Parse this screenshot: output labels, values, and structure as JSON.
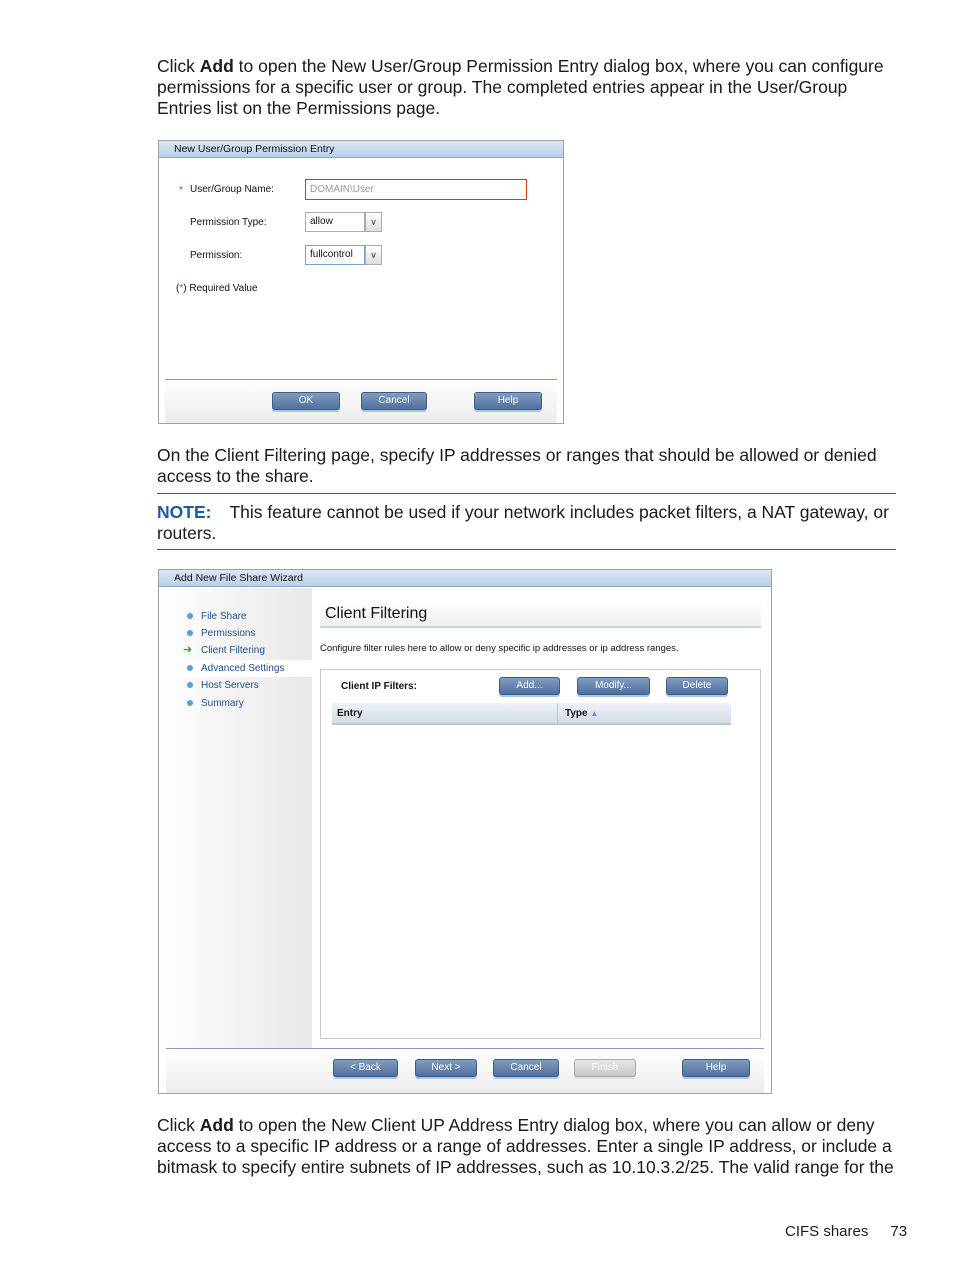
{
  "paragraphs": {
    "p1": {
      "pre": "Click ",
      "bold": "Add",
      "post": " to open the New User/Group Permission Entry dialog box, where you can configure permissions for a specific user or group. The completed entries appear in the User/Group Entries list on the Permissions page."
    },
    "p2": "On the Client Filtering page, specify IP addresses or ranges that should be allowed or denied access to the share.",
    "note": {
      "label": "NOTE:",
      "text": "This feature cannot be used if your network includes packet filters, a NAT gateway, or routers."
    },
    "p3": {
      "pre": "Click ",
      "bold": "Add",
      "post": " to open the New Client UP Address Entry dialog box, where you can allow or deny access to a specific IP address or a range of addresses. Enter a single IP address, or include a bitmask to specify entire subnets of IP addresses, such as 10.10.3.2/25. The valid range for the"
    }
  },
  "dialog1": {
    "title": "New User/Group Permission Entry",
    "required_mark": "*",
    "user_label": "User/Group Name:",
    "user_value": "DOMAIN\\User",
    "type_label": "Permission Type:",
    "type_value": "allow",
    "perm_label": "Permission:",
    "perm_value": "fullcontrol",
    "required_open": "(",
    "required_close": ") Required Value",
    "buttons": {
      "ok": "OK",
      "cancel": "Cancel",
      "help": "Help"
    }
  },
  "wizard": {
    "title": "Add New File Share Wizard",
    "nav": [
      {
        "label": "File Share"
      },
      {
        "label": "Permissions"
      },
      {
        "label": "Client Filtering",
        "current": true
      },
      {
        "label": "Advanced Settings"
      },
      {
        "label": "Host Servers"
      },
      {
        "label": "Summary"
      }
    ],
    "heading": "Client Filtering",
    "description": "Configure filter rules here to allow or deny specific ip addresses or ip address ranges.",
    "filters_label": "Client IP Filters:",
    "filter_buttons": {
      "add": "Add...",
      "modify": "Modify...",
      "delete": "Delete"
    },
    "columns": [
      "Entry",
      "Type"
    ],
    "sort_icon": "sort-ascending-icon",
    "buttons": {
      "back": "< Back",
      "next": "Next >",
      "cancel": "Cancel",
      "finish": "Finish",
      "help": "Help"
    }
  },
  "footer": {
    "section": "CIFS shares",
    "page": "73"
  }
}
